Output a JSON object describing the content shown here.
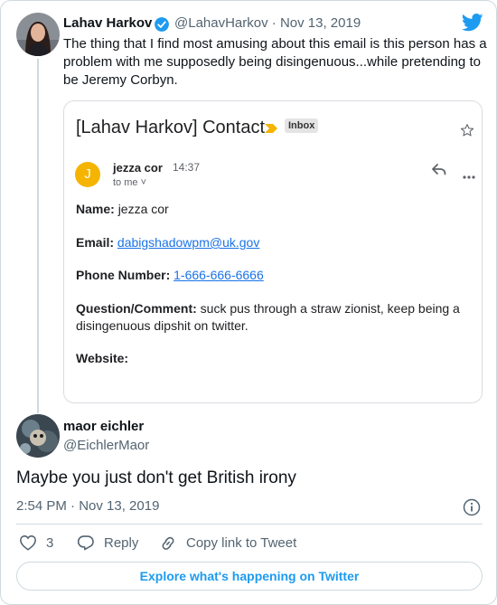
{
  "tweet1": {
    "name": "Lahav Harkov",
    "handle_date": "@LahavHarkov · Nov 13, 2019",
    "text": "The thing that I find most amusing about this email is this person has a problem with me supposedly being disingenuous...while pretending to be Jeremy Corbyn."
  },
  "email": {
    "subject": "[Lahav Harkov] Contact",
    "label": "Inbox",
    "sender_initial": "J",
    "sender_name": "jezza cor",
    "time": "14:37",
    "to": "to me ˅",
    "name_label": "Name:",
    "name_value": "jezza cor",
    "email_label": "Email:",
    "email_value": "dabigshadowpm@uk.gov",
    "phone_label": "Phone Number:",
    "phone_value": "1-666-666-6666",
    "comment_label": "Question/Comment:",
    "comment_value": "suck pus through a straw zionist, keep being a disingenuous dipshit on twitter.",
    "website_label": "Website:"
  },
  "tweet2": {
    "name": "maor eichler",
    "handle": "@EichlerMaor",
    "text": "Maybe you just don't get British irony",
    "timestamp": "2:54 PM · Nov 13, 2019"
  },
  "actions": {
    "like_count": "3",
    "reply_label": "Reply",
    "copy_label": "Copy link to Tweet"
  },
  "explore_label": "Explore what's happening on Twitter",
  "colors": {
    "twitter_blue": "#1d9bf0",
    "gmail_link": "#1a73e8",
    "avatar_yellow": "#f4b400"
  }
}
